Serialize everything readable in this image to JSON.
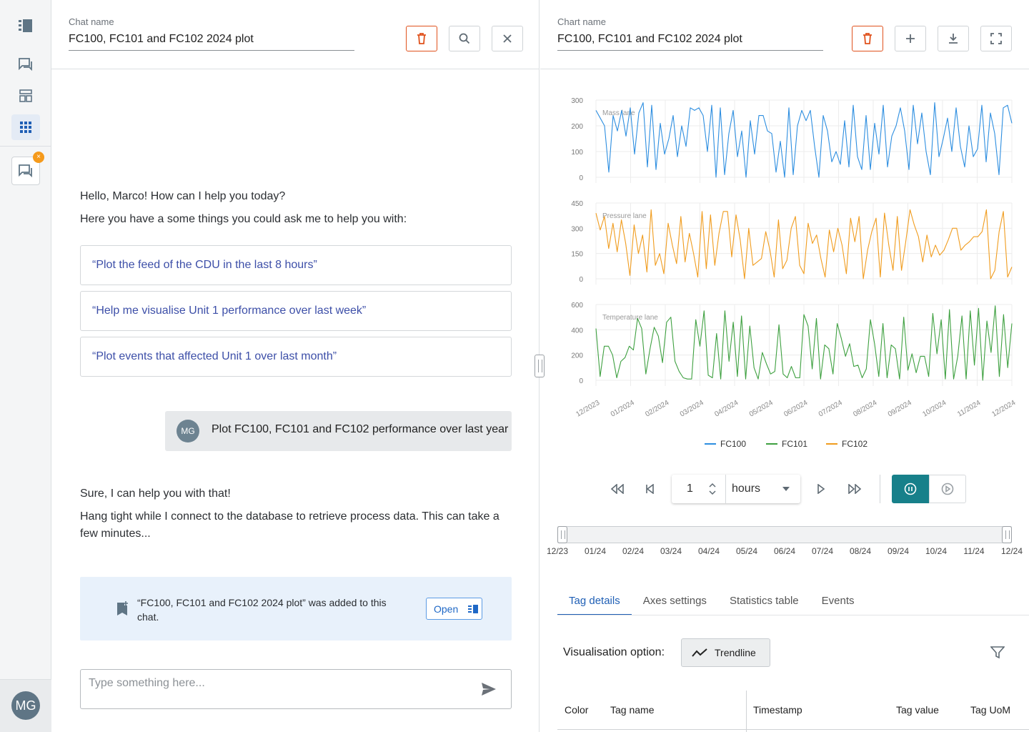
{
  "chat": {
    "name_label": "Chat name",
    "name_value": "FC100, FC101 and FC102 2024 plot",
    "greeting": "Hello, Marco! How can I help you today?",
    "intro": "Here you have a some things you could ask me to help you with:",
    "suggestions": [
      "“Plot the feed of the CDU in the last 8 hours”",
      "“Help me visualise Unit 1 performance over last week”",
      "“Plot events that affected Unit 1 over last month”"
    ],
    "user_initials": "MG",
    "user_message": "Plot FC100, FC101 and FC102 performance over last year",
    "reply_line1": "Sure, I can help you with that!",
    "reply_line2": "Hang tight while I connect to the database to retrieve process data. This can take a few minutes...",
    "notice_text": "“FC100, FC101 and FC102 2024 plot” was added to this chat.",
    "open_label": "Open",
    "input_placeholder": "Type something here..."
  },
  "rail": {
    "avatar_initials": "MG",
    "badge": "×"
  },
  "chart_panel": {
    "name_label": "Chart name",
    "name_value": "FC100, FC101 and FC102 2024 plot",
    "step_value": "1",
    "step_unit": "hours",
    "range_labels": [
      "12/23",
      "01/24",
      "02/24",
      "03/24",
      "04/24",
      "05/24",
      "06/24",
      "07/24",
      "08/24",
      "09/24",
      "10/24",
      "11/24",
      "12/24"
    ],
    "tabs": [
      "Tag details",
      "Axes settings",
      "Statistics table",
      "Events"
    ],
    "active_tab": 0,
    "vis_label": "Visualisation option:",
    "trend_label": "Trendline",
    "table_headers": {
      "color": "Color",
      "tag_name": "Tag name",
      "timestamp": "Timestamp",
      "tag_value": "Tag value",
      "tag_uom": "Tag UoM"
    }
  },
  "chart_data": {
    "type": "line",
    "x_categories": [
      "12/2023",
      "01/2024",
      "02/2024",
      "03/2024",
      "04/2024",
      "05/2024",
      "06/2024",
      "07/2024",
      "08/2024",
      "09/2024",
      "10/2024",
      "11/2024",
      "12/2024"
    ],
    "lanes": [
      {
        "name": "Mass lane",
        "ticks": [
          0,
          100,
          200,
          300
        ],
        "ylim": [
          0,
          300
        ],
        "series": "FC100",
        "color": "#2d8ee0",
        "values": [
          260,
          230,
          200,
          20,
          240,
          180,
          260,
          160,
          270,
          90,
          250,
          290,
          40,
          280,
          30,
          210,
          90,
          150,
          240,
          80,
          200,
          120,
          270,
          260,
          270,
          240,
          100,
          280,
          0,
          270,
          10,
          170,
          260,
          80,
          180,
          0,
          220,
          90,
          240,
          240,
          180,
          170,
          20,
          140,
          0,
          270,
          10,
          200,
          260,
          220,
          260,
          120,
          0,
          240,
          180,
          60,
          100,
          50,
          220,
          40,
          280,
          80,
          30,
          240,
          30,
          210,
          90,
          280,
          40,
          160,
          200,
          270,
          180,
          30,
          280,
          130,
          250,
          100,
          10,
          290,
          80,
          150,
          230,
          100,
          270,
          120,
          40,
          200,
          80,
          110,
          280,
          60,
          250,
          170,
          10,
          270,
          280,
          210
        ]
      },
      {
        "name": "Pressure lane",
        "ticks": [
          0,
          150,
          300,
          450
        ],
        "ylim": [
          0,
          450
        ],
        "series": "FC102",
        "color": "#f09c1e",
        "values": [
          390,
          290,
          370,
          180,
          330,
          160,
          350,
          210,
          20,
          320,
          150,
          260,
          40,
          410,
          80,
          150,
          30,
          330,
          200,
          90,
          370,
          100,
          270,
          150,
          10,
          400,
          60,
          380,
          80,
          270,
          400,
          400,
          130,
          380,
          230,
          0,
          300,
          80,
          100,
          120,
          280,
          170,
          10,
          350,
          60,
          110,
          300,
          370,
          80,
          30,
          330,
          210,
          260,
          120,
          10,
          290,
          160,
          300,
          200,
          30,
          360,
          220,
          370,
          0,
          170,
          280,
          360,
          10,
          390,
          200,
          50,
          370,
          50,
          220,
          410,
          320,
          250,
          100,
          260,
          130,
          200,
          140,
          170,
          230,
          300,
          300,
          170,
          200,
          220,
          250,
          250,
          280,
          410,
          0,
          50,
          280,
          400,
          10,
          70
        ]
      },
      {
        "name": "Temperature lane",
        "ticks": [
          0,
          200,
          400,
          600
        ],
        "ylim": [
          0,
          600
        ],
        "series": "FC101",
        "color": "#3ea040",
        "values": [
          410,
          30,
          270,
          270,
          200,
          20,
          150,
          180,
          270,
          240,
          490,
          410,
          50,
          250,
          420,
          350,
          140,
          460,
          500,
          150,
          70,
          20,
          10,
          10,
          480,
          270,
          550,
          40,
          20,
          370,
          10,
          550,
          150,
          460,
          30,
          510,
          10,
          430,
          100,
          10,
          220,
          130,
          50,
          70,
          440,
          50,
          20,
          110,
          20,
          20,
          520,
          430,
          90,
          490,
          10,
          280,
          250,
          50,
          450,
          330,
          190,
          290,
          110,
          120,
          20,
          90,
          480,
          290,
          30,
          450,
          20,
          280,
          250,
          10,
          500,
          80,
          210,
          60,
          190,
          190,
          30,
          530,
          210,
          480,
          10,
          560,
          10,
          190,
          510,
          10,
          550,
          120,
          570,
          0,
          470,
          220,
          590,
          30,
          520,
          100,
          450
        ]
      }
    ],
    "legend": [
      {
        "name": "FC100",
        "color": "#2d8ee0"
      },
      {
        "name": "FC101",
        "color": "#3ea040"
      },
      {
        "name": "FC102",
        "color": "#f09c1e"
      }
    ],
    "grid": true
  }
}
